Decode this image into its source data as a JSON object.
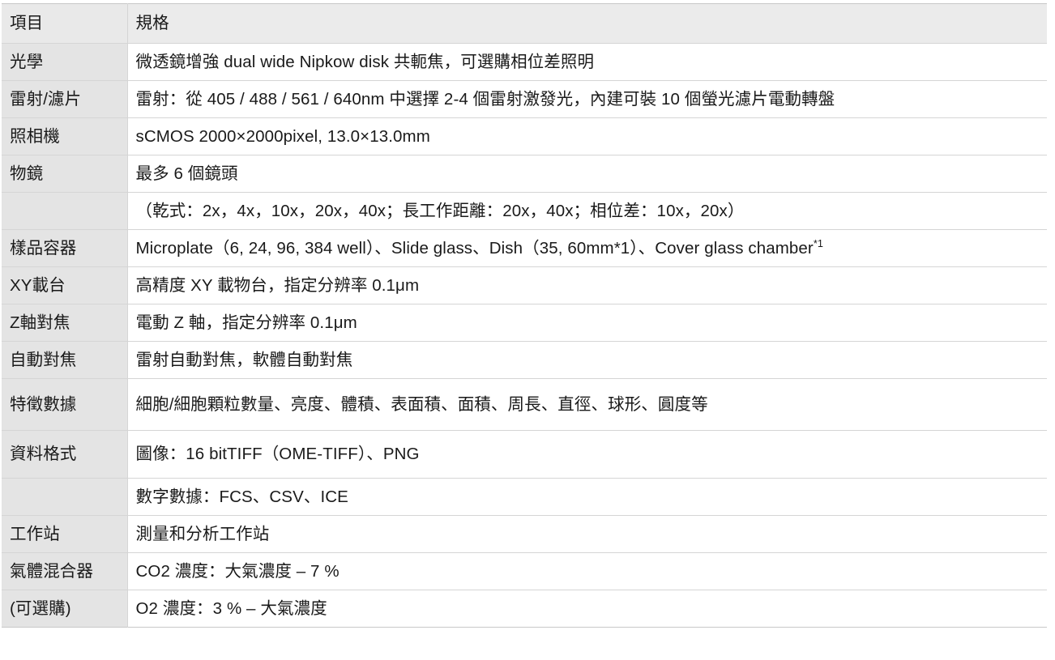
{
  "table": {
    "header": {
      "item_label": "項目",
      "spec_label": "規格"
    },
    "rows": [
      {
        "label": "光學",
        "value": "微透鏡增強 dual wide Nipkow disk 共軛焦，可選購相位差照明"
      },
      {
        "label": "雷射/濾片",
        "value": "雷射：從 405 / 488 / 561 / 640nm 中選擇 2-4 個雷射激發光，內建可裝 10 個螢光濾片電動轉盤"
      },
      {
        "label": "照相機",
        "value": "sCMOS 2000×2000pixel, 13.0×13.0mm"
      },
      {
        "label": "物鏡",
        "value": "最多 6 個鏡頭"
      },
      {
        "label": "",
        "value": "（乾式：2x，4x，10x，20x，40x；長工作距離：20x，40x；相位差：10x，20x）"
      },
      {
        "label": "樣品容器",
        "value": "Microplate（6, 24, 96, 384  well）、Slide glass、Dish（35, 60mm*1）、Cover glass chamber",
        "superscript": "*1"
      },
      {
        "label": "XY載台",
        "value": "高精度 XY 載物台，指定分辨率 0.1μm"
      },
      {
        "label": "Z軸對焦",
        "value": "電動 Z 軸，指定分辨率 0.1μm"
      },
      {
        "label": "自動對焦",
        "value": "雷射自動對焦，軟體自動對焦"
      },
      {
        "label": "特徵數據",
        "value": "細胞/細胞顆粒數量、亮度、體積、表面積、面積、周長、直徑、球形、圓度等"
      },
      {
        "label": "資料格式",
        "value": "圖像：16 bitTIFF（OME-TIFF）、PNG"
      },
      {
        "label": "",
        "value": "數字數據：FCS、CSV、ICE"
      },
      {
        "label": "工作站",
        "value": "測量和分析工作站"
      },
      {
        "label": "氣體混合器",
        "value": "CO2 濃度：大氣濃度 – 7 %"
      },
      {
        "label": "(可選購)",
        "value": "O2 濃度：3 % –  大氣濃度"
      }
    ]
  },
  "colors": {
    "label_background": "#e4e4e4",
    "header_background": "#ebebeb",
    "value_background": "#ffffff",
    "border": "#d5d5d5",
    "text": "#1a1a1a"
  }
}
